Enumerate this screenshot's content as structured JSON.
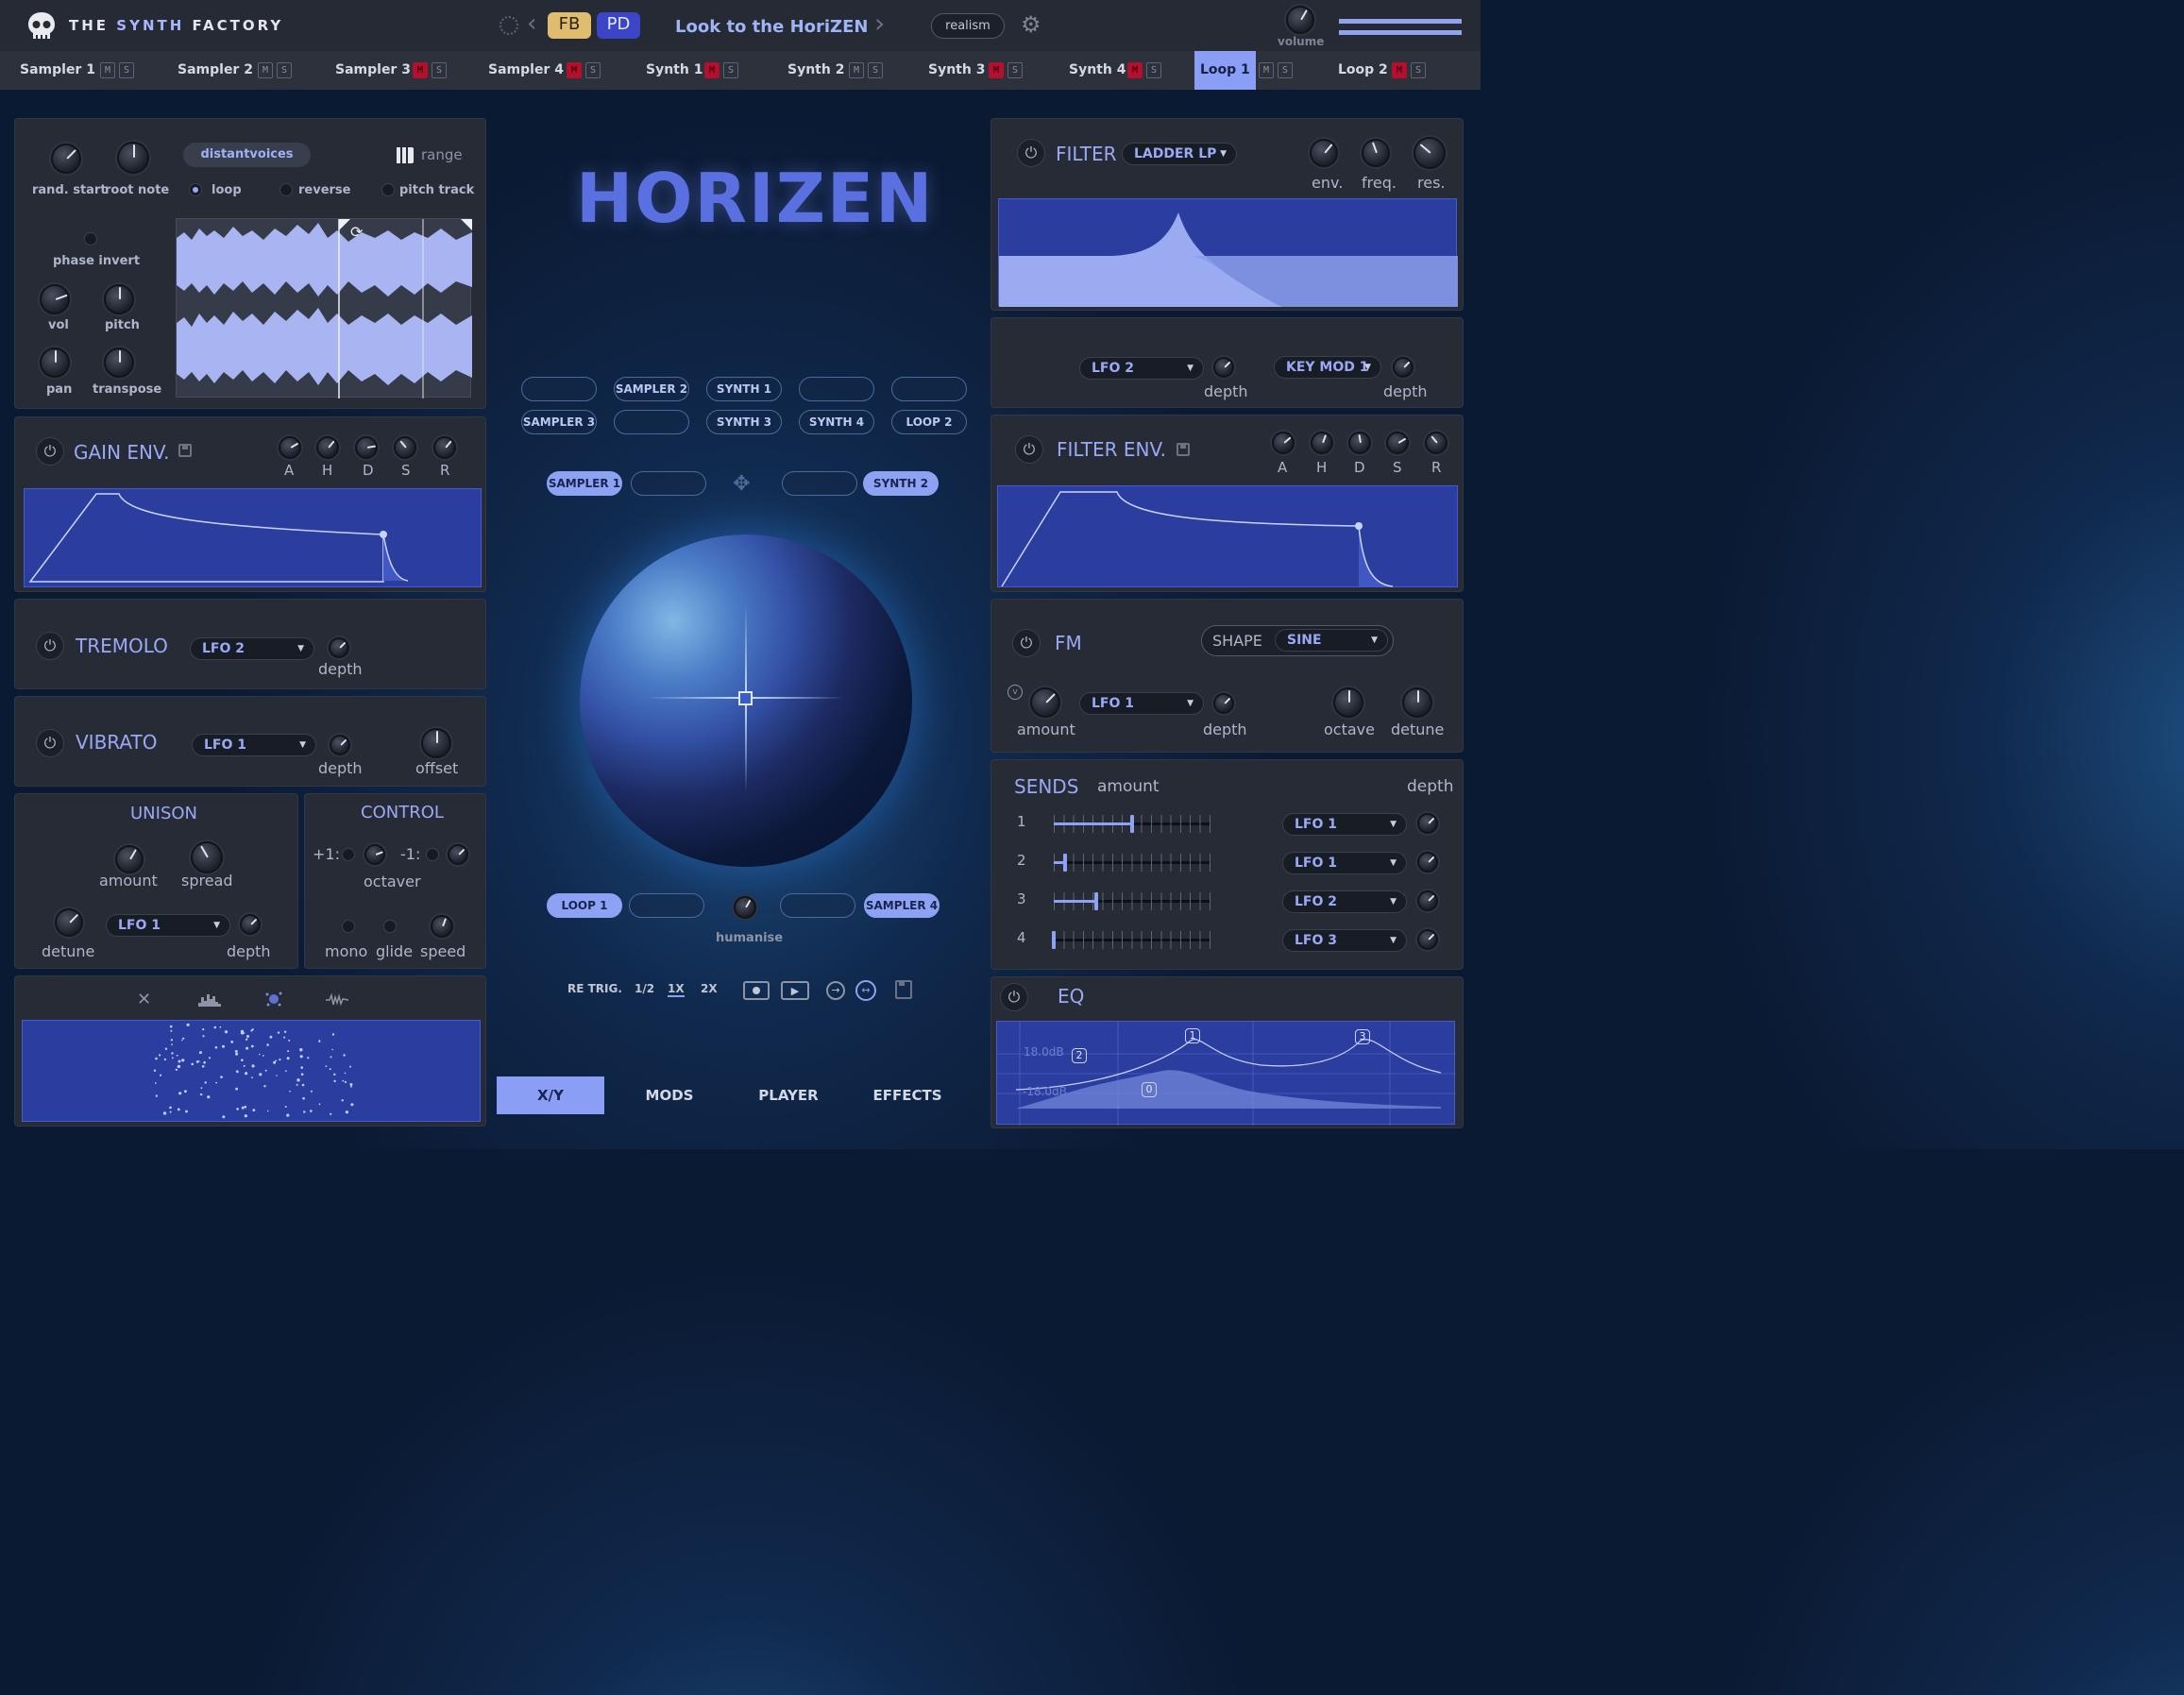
{
  "brand": {
    "pre": "THE",
    "synth": "SYNTH",
    "post": "FACTORY"
  },
  "topbar": {
    "chip_fb": "FB",
    "chip_pd": "PD",
    "preset_name": "Look to the HoriZEN",
    "mode": "realism",
    "volume_label": "volume"
  },
  "tabs": [
    {
      "label": "Sampler 1",
      "m": "M",
      "s": "S",
      "muted": false
    },
    {
      "label": "Sampler 2",
      "m": "M",
      "s": "S",
      "muted": false
    },
    {
      "label": "Sampler 3",
      "m": "M",
      "s": "S",
      "muted": true
    },
    {
      "label": "Sampler 4",
      "m": "M",
      "s": "S",
      "muted": true
    },
    {
      "label": "Synth 1",
      "m": "M",
      "s": "S",
      "muted": true
    },
    {
      "label": "Synth 2",
      "m": "M",
      "s": "S",
      "muted": false
    },
    {
      "label": "Synth 3",
      "m": "M",
      "s": "S",
      "muted": true
    },
    {
      "label": "Synth 4",
      "m": "M",
      "s": "S",
      "muted": true
    },
    {
      "label": "Loop 1",
      "m": "M",
      "s": "S",
      "muted": false,
      "active": true
    },
    {
      "label": "Loop 2",
      "m": "M",
      "s": "S",
      "muted": true
    }
  ],
  "sample": {
    "rand_start": "rand. start",
    "root_note": "root note",
    "name": "distantvoices",
    "range": "range",
    "loop": "loop",
    "reverse": "reverse",
    "pitch_track": "pitch track",
    "phase_invert": "phase invert",
    "vol": "vol",
    "pitch": "pitch",
    "pan": "pan",
    "transpose": "transpose"
  },
  "gain_env": {
    "title": "GAIN ENV.",
    "a": "A",
    "h": "H",
    "d": "D",
    "s": "S",
    "r": "R"
  },
  "tremolo": {
    "title": "TREMOLO",
    "source": "LFO 2",
    "depth": "depth"
  },
  "vibrato": {
    "title": "VIBRATO",
    "source": "LFO 1",
    "depth": "depth",
    "offset": "offset"
  },
  "unison": {
    "title": "UNISON",
    "amount": "amount",
    "spread": "spread",
    "detune": "detune",
    "source": "LFO 1",
    "depth": "depth"
  },
  "control": {
    "title": "CONTROL",
    "plus1": "+1:",
    "minus1": "-1:",
    "octaver": "octaver",
    "mono": "mono",
    "glide": "glide",
    "speed": "speed"
  },
  "display_tabs": {
    "close": "✕"
  },
  "center": {
    "logo": "HORIZEN",
    "pills_row1": [
      "",
      "SAMPLER 2",
      "SYNTH 1",
      "",
      ""
    ],
    "pills_row2": [
      "SAMPLER 3",
      "",
      "SYNTH 3",
      "SYNTH 4",
      "LOOP 2"
    ],
    "xy_top_left": "SAMPLER 1",
    "xy_top_right": "SYNTH 2",
    "xy_bottom_left": "LOOP 1",
    "xy_bottom_right": "SAMPLER 4",
    "humanise": "humanise",
    "retrig": "RE TRIG.",
    "rate_half": "1/2",
    "rate_1x": "1X",
    "rate_2x": "2X",
    "nav": [
      "X/Y",
      "MODS",
      "PLAYER",
      "EFFECTS"
    ]
  },
  "filter": {
    "title": "FILTER",
    "type": "LADDER LP",
    "env": "env.",
    "freq": "freq.",
    "res": "res.",
    "mod1_source": "LFO 2",
    "mod1_depth": "depth",
    "mod2_source": "KEY MOD 1",
    "mod2_depth": "depth"
  },
  "filter_env": {
    "title": "FILTER ENV.",
    "a": "A",
    "h": "H",
    "d": "D",
    "s": "S",
    "r": "R"
  },
  "fm": {
    "title": "FM",
    "shape_label": "SHAPE",
    "shape": "SINE",
    "amount": "amount",
    "source": "LFO 1",
    "depth": "depth",
    "octave": "octave",
    "detune": "detune"
  },
  "sends": {
    "title": "SENDS",
    "amount": "amount",
    "depth": "depth",
    "rows": [
      {
        "n": "1",
        "level": 0.5,
        "src": "LFO 1"
      },
      {
        "n": "2",
        "level": 0.07,
        "src": "LFO 1"
      },
      {
        "n": "3",
        "level": 0.27,
        "src": "LFO 2"
      },
      {
        "n": "4",
        "level": 0.0,
        "src": "LFO 3"
      }
    ]
  },
  "eq": {
    "title": "EQ",
    "gain_top": "18.0dB",
    "gain_bottom": "-18.0dB",
    "bands": [
      "0",
      "1",
      "2",
      "3"
    ]
  },
  "colors": {
    "accent": "#8da2f2",
    "panel": "#262b36",
    "display": "#2b3d9e",
    "mute": "#b2102c"
  }
}
